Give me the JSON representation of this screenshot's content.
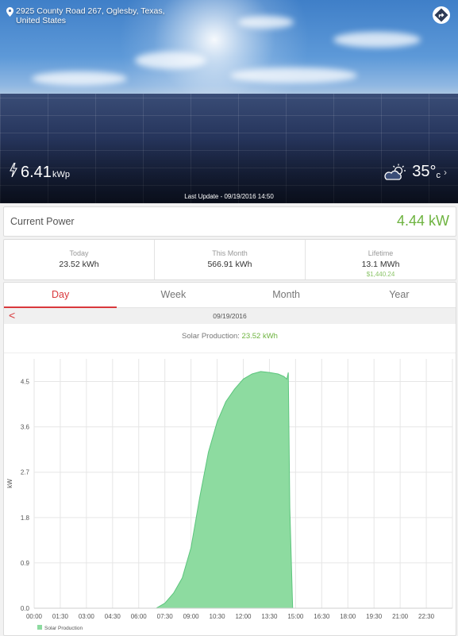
{
  "header": {
    "address": "2925 County Road 267, Oglesby, Texas, United States",
    "peak_power_value": "6.41",
    "peak_power_unit": "kWp",
    "temperature": "35°",
    "temperature_unit": "c",
    "last_update": "Last Update - 09/19/2016 14:50"
  },
  "current_power": {
    "label": "Current Power",
    "value": "4.44 kW"
  },
  "stats": {
    "today_label": "Today",
    "today_value": "23.52 kWh",
    "month_label": "This Month",
    "month_value": "566.91 kWh",
    "lifetime_label": "Lifetime",
    "lifetime_value": "13.1 MWh",
    "lifetime_money": "$1,440.24"
  },
  "tabs": [
    "Day",
    "Week",
    "Month",
    "Year"
  ],
  "date_nav": {
    "prev_glyph": "<",
    "date": "09/19/2016"
  },
  "production": {
    "label": "Solar Production:",
    "value": "23.52 kWh"
  },
  "colors": {
    "accent_red": "#d9383c",
    "green_value": "#6db33f",
    "series_fill": "#8ddba0",
    "series_stroke": "#5cc57d"
  },
  "chart_data": {
    "type": "area",
    "ylabel": "kW",
    "ylim": [
      0,
      4.95
    ],
    "yticks": [
      "0.0",
      "0.9",
      "1.8",
      "2.7",
      "3.6",
      "4.5"
    ],
    "xticks": [
      "00:00",
      "01:30",
      "03:00",
      "04:30",
      "06:00",
      "07:30",
      "09:00",
      "10:30",
      "12:00",
      "13:30",
      "15:00",
      "16:30",
      "18:00",
      "19:30",
      "21:00",
      "22:30"
    ],
    "legend": "Solar Production",
    "series": [
      {
        "name": "Solar Production",
        "x": [
          "00:00",
          "07:00",
          "07:30",
          "08:00",
          "08:30",
          "09:00",
          "09:30",
          "10:00",
          "10:30",
          "11:00",
          "11:30",
          "12:00",
          "12:30",
          "13:00",
          "13:30",
          "14:00",
          "14:20",
          "14:30",
          "14:35",
          "14:40",
          "14:50",
          "15:00",
          "24:00"
        ],
        "y": [
          0,
          0,
          0.1,
          0.3,
          0.6,
          1.2,
          2.2,
          3.1,
          3.7,
          4.1,
          4.35,
          4.55,
          4.65,
          4.7,
          4.68,
          4.65,
          4.6,
          4.55,
          4.68,
          2.0,
          0,
          0,
          0
        ]
      }
    ]
  }
}
